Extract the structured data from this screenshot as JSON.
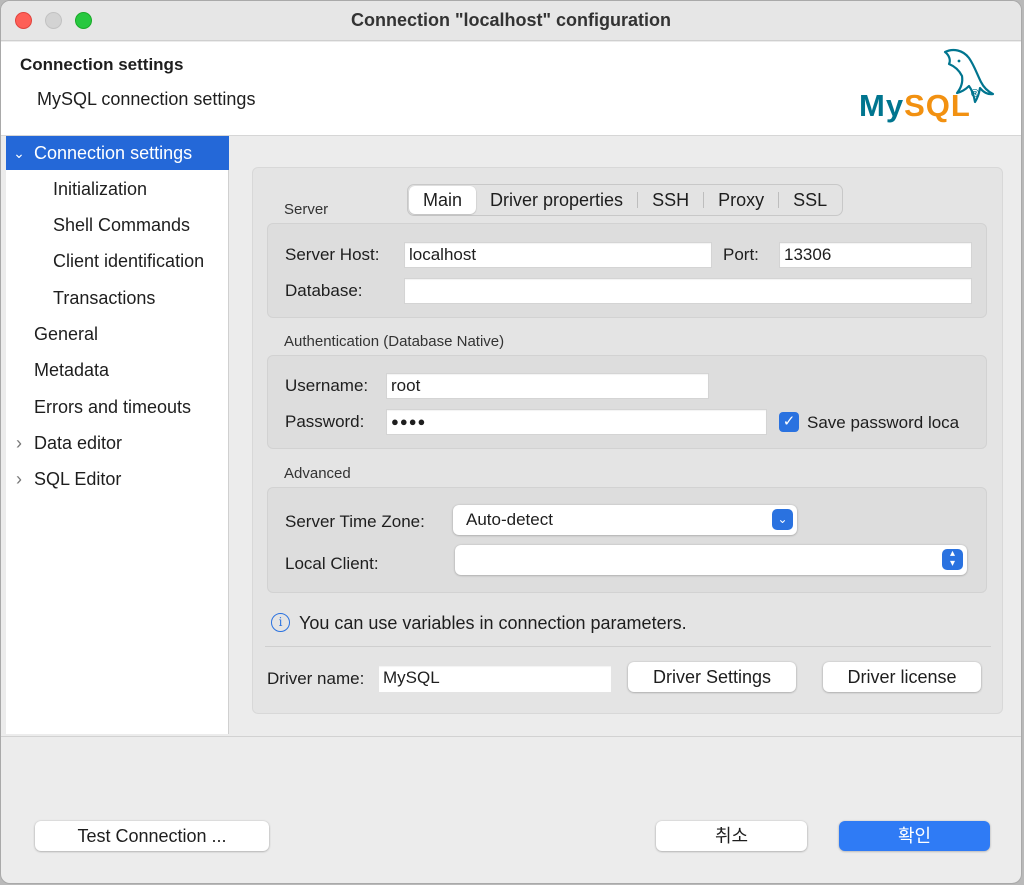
{
  "window": {
    "title": "Connection \"localhost\" configuration"
  },
  "header": {
    "title": "Connection settings",
    "subtitle": "MySQL connection settings"
  },
  "sidebar": {
    "items": [
      {
        "label": "Connection settings",
        "expander": "⌄",
        "selected": true
      },
      {
        "label": "Initialization"
      },
      {
        "label": "Shell Commands"
      },
      {
        "label": "Client identification"
      },
      {
        "label": "Transactions"
      },
      {
        "label": "General"
      },
      {
        "label": "Metadata"
      },
      {
        "label": "Errors and timeouts"
      },
      {
        "label": "Data editor",
        "expander": "›"
      },
      {
        "label": "SQL Editor",
        "expander": "›"
      }
    ]
  },
  "tabs": [
    "Main",
    "Driver properties",
    "SSH",
    "Proxy",
    "SSL"
  ],
  "server": {
    "section": "Server",
    "host_label": "Server Host:",
    "host_value": "localhost",
    "port_label": "Port:",
    "port_value": "13306",
    "database_label": "Database:",
    "database_value": ""
  },
  "auth": {
    "section": "Authentication (Database Native)",
    "username_label": "Username:",
    "username_value": "root",
    "password_label": "Password:",
    "password_value": "●●●●",
    "save_password_label": "Save password loca",
    "save_password_checked": true
  },
  "advanced": {
    "section": "Advanced",
    "timezone_label": "Server Time Zone:",
    "timezone_value": "Auto-detect",
    "local_client_label": "Local Client:",
    "local_client_value": ""
  },
  "info": {
    "text": "You can use variables in connection parameters.",
    "icon": "i"
  },
  "driver": {
    "name_label": "Driver name:",
    "name_value": "MySQL",
    "settings_button": "Driver Settings",
    "license_button": "Driver license"
  },
  "footer": {
    "test_button": "Test Connection ...",
    "cancel_button": "취소",
    "ok_button": "확인"
  },
  "logo": {
    "part1": "My",
    "part2": "SQL",
    "trademark": "®"
  },
  "colors": {
    "accent": "#2468d8",
    "primary_button": "#2f7bf5",
    "logo_blue": "#00758f",
    "logo_orange": "#f29111"
  }
}
